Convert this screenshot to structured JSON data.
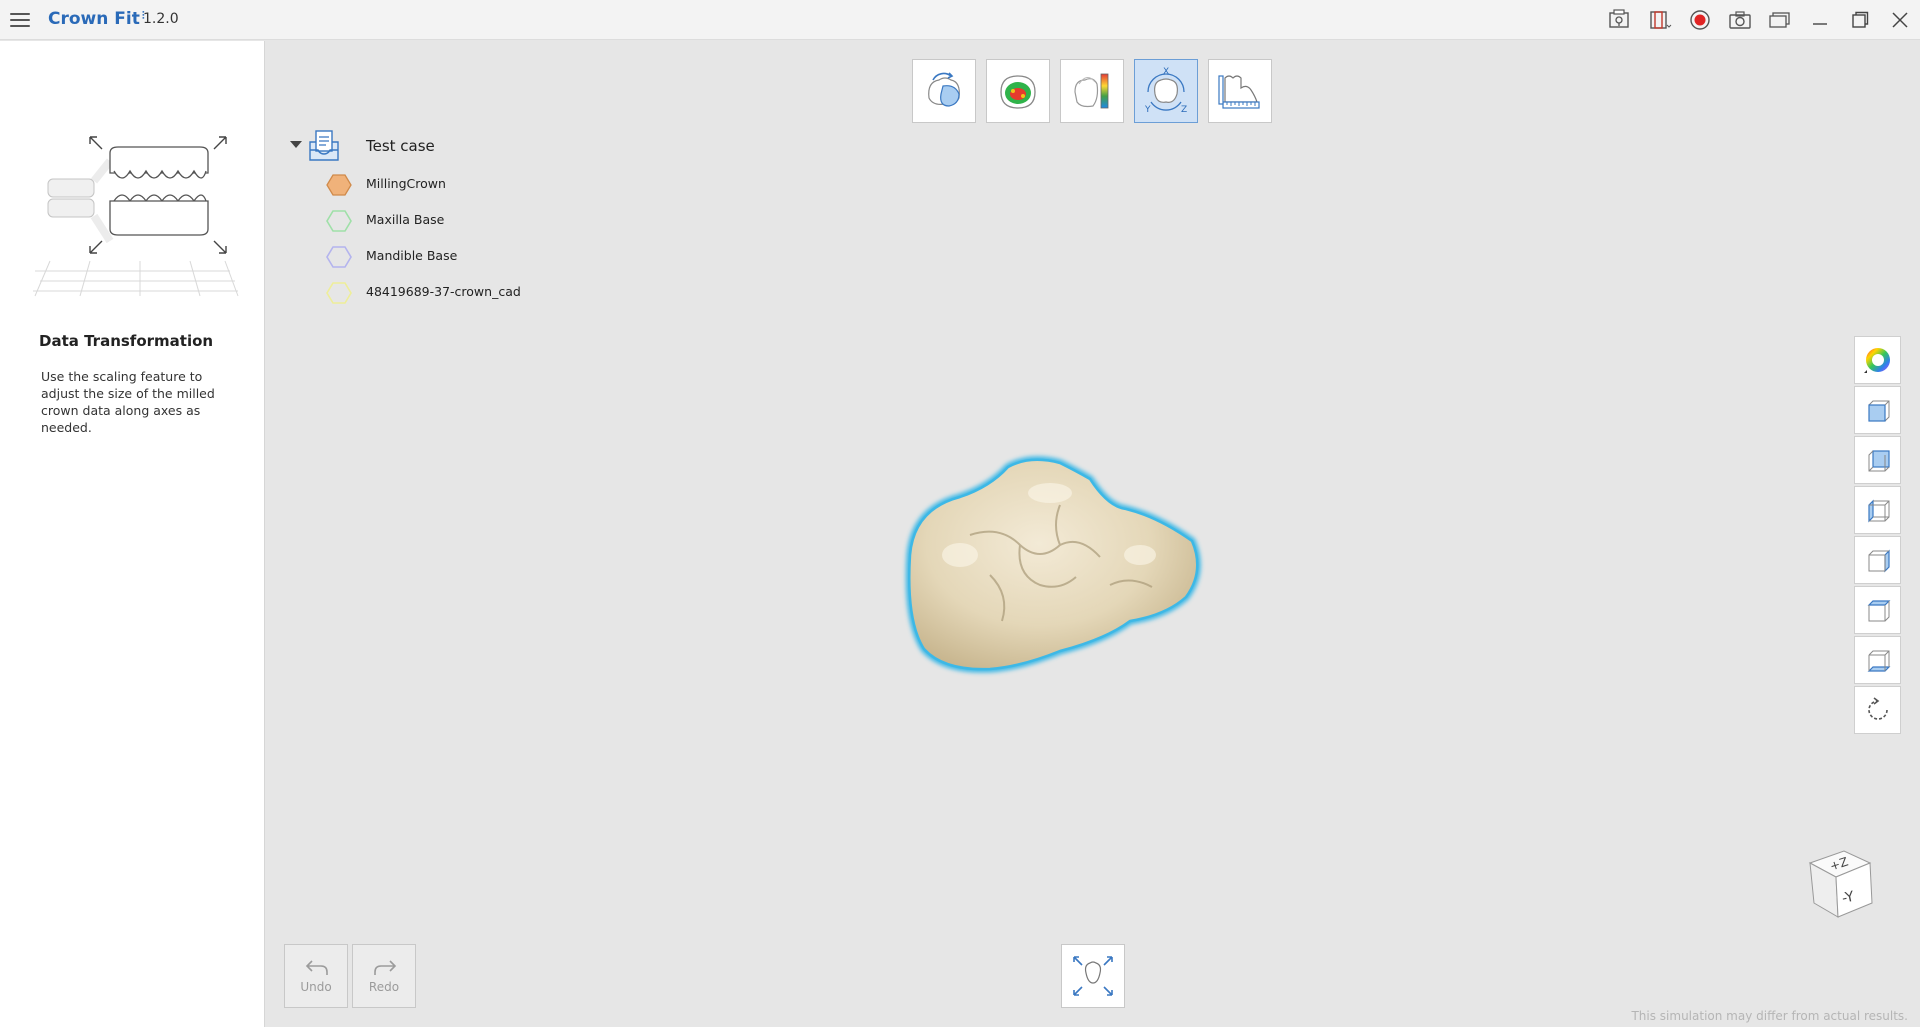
{
  "app": {
    "title": "Crown Fit",
    "version": "1.2.0"
  },
  "guide": {
    "title": "Data Transformation",
    "description": "Use the scaling feature to adjust the size of the milled crown data along axes as needed."
  },
  "tree": {
    "root_label": "Test case",
    "items": [
      {
        "label": "MillingCrown",
        "color": "#f0b27a",
        "filled": true
      },
      {
        "label": "Maxilla Base",
        "color": "#9fe0a8",
        "filled": false
      },
      {
        "label": "Mandible Base",
        "color": "#b4b4ee",
        "filled": false
      },
      {
        "label": "48419689-37-crown_cad",
        "color": "#eeee99",
        "filled": false
      }
    ]
  },
  "toolbar": {
    "tools": [
      {
        "icon": "rotate-crown-icon",
        "active": false
      },
      {
        "icon": "heatmap-icon",
        "active": false
      },
      {
        "icon": "color-scale-icon",
        "active": false
      },
      {
        "icon": "xyz-transform-icon",
        "active": true,
        "axis_x": "X",
        "axis_y": "Y",
        "axis_z": "Z"
      },
      {
        "icon": "measure-icon",
        "active": false
      }
    ]
  },
  "undo": {
    "label": "Undo"
  },
  "redo": {
    "label": "Redo"
  },
  "view_cube": {
    "top_face": "+Z",
    "front_face": "-Y"
  },
  "accent_color": "#2a6ab8",
  "highlight_color": "#3db8e6",
  "disclaimer": "This simulation may differ from actual results."
}
